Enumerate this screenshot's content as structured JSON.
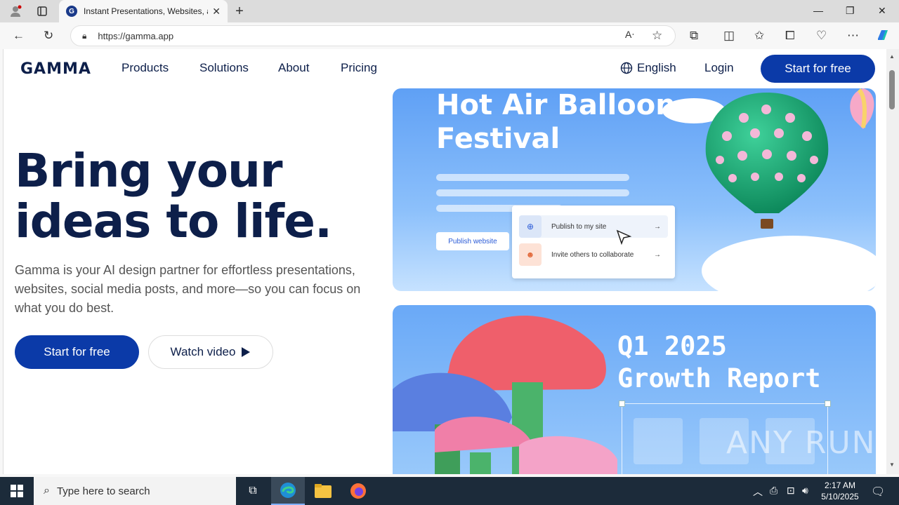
{
  "browser": {
    "tab_title": "Instant Presentations, Websites, a",
    "url": "https://gamma.app",
    "new_tab_symbol": "+"
  },
  "nav": {
    "logo": "GAMMA",
    "links": [
      "Products",
      "Solutions",
      "About",
      "Pricing"
    ],
    "language": "English",
    "login": "Login",
    "cta": "Start for free"
  },
  "hero": {
    "title_line1": "Bring your",
    "title_line2": "ideas to life.",
    "subtitle": "Gamma is your AI design partner for effortless presentations, websites, social media posts, and more—so you can focus on what you do best.",
    "cta_primary": "Start for free",
    "cta_secondary": "Watch video"
  },
  "card1": {
    "title_line1": "Hot Air Balloon",
    "title_line2": "Festival",
    "publish_button": "Publish website",
    "menu_items": [
      "Publish to my site",
      "Invite others to collaborate"
    ]
  },
  "card2": {
    "title_line1": "Q1 2025",
    "title_line2": "Growth Report"
  },
  "watermark": "ANY RUN",
  "taskbar": {
    "search_placeholder": "Type here to search",
    "time": "2:17 AM",
    "date": "5/10/2025"
  },
  "colors": {
    "brand_navy": "#0d1f4a",
    "cta_blue": "#0b3aa8",
    "card_blue": "#6aa9f7"
  },
  "icons": [
    "profile-icon",
    "tabs-icon",
    "close-icon",
    "new-tab-icon",
    "minimize-icon",
    "restore-icon",
    "back-icon",
    "refresh-icon",
    "lock-icon",
    "read-aloud-icon",
    "favorite-star-icon",
    "extensions-icon",
    "split-screen-icon",
    "favorites-icon",
    "collections-icon",
    "performance-icon",
    "more-icon",
    "copilot-icon",
    "globe-icon",
    "play-icon",
    "windows-start-icon",
    "search-icon",
    "task-view-icon",
    "edge-icon",
    "file-explorer-icon",
    "firefox-icon",
    "chevron-up-icon",
    "network-icon",
    "volume-icon",
    "notification-icon"
  ]
}
